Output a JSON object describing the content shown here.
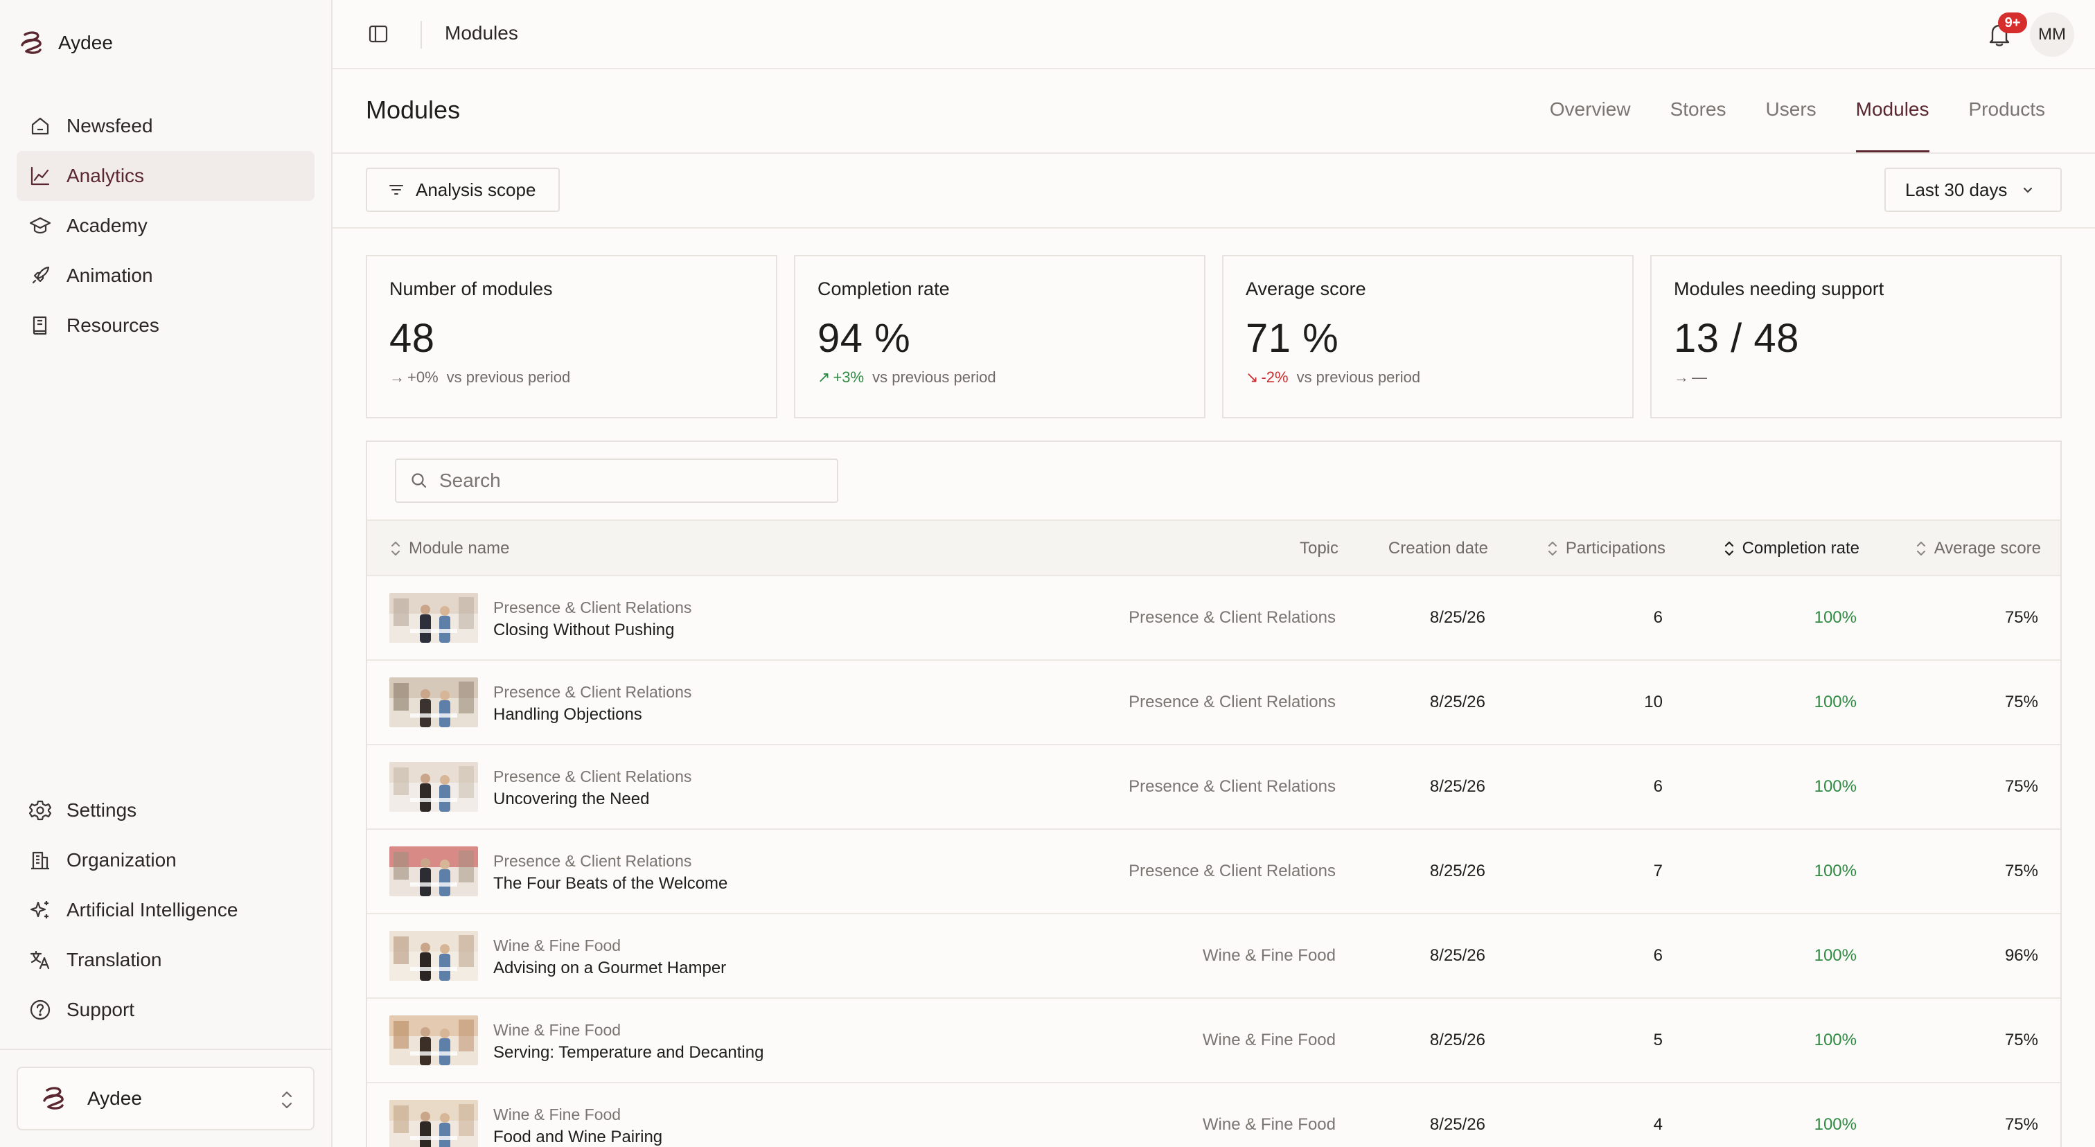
{
  "app": {
    "name": "Aydee"
  },
  "sidebar": {
    "main_items": [
      {
        "label": "Newsfeed",
        "icon": "home-icon"
      },
      {
        "label": "Analytics",
        "icon": "chart-icon",
        "active": true
      },
      {
        "label": "Academy",
        "icon": "graduation-cap-icon"
      },
      {
        "label": "Animation",
        "icon": "rocket-icon"
      },
      {
        "label": "Resources",
        "icon": "book-icon"
      }
    ],
    "bottom_items": [
      {
        "label": "Settings",
        "icon": "gear-icon"
      },
      {
        "label": "Organization",
        "icon": "building-icon"
      },
      {
        "label": "Artificial Intelligence",
        "icon": "sparkles-icon"
      },
      {
        "label": "Translation",
        "icon": "translate-icon"
      },
      {
        "label": "Support",
        "icon": "help-circle-icon"
      }
    ],
    "workspace": "Aydee"
  },
  "topbar": {
    "breadcrumb": "Modules",
    "notification_badge": "9+",
    "avatar_initials": "MM"
  },
  "page": {
    "title": "Modules",
    "tabs": [
      {
        "label": "Overview"
      },
      {
        "label": "Stores"
      },
      {
        "label": "Users"
      },
      {
        "label": "Modules",
        "active": true
      },
      {
        "label": "Products"
      }
    ]
  },
  "toolbar": {
    "scope_label": "Analysis scope",
    "range_label": "Last 30 days"
  },
  "kpis": [
    {
      "title": "Number of modules",
      "value": "48",
      "arrow": "→",
      "change": "+0%",
      "trend": "flat",
      "suffix": "vs previous period"
    },
    {
      "title": "Completion rate",
      "value": "94 %",
      "arrow": "↗",
      "change": "+3%",
      "trend": "up",
      "suffix": "vs previous period"
    },
    {
      "title": "Average score",
      "value": "71 %",
      "arrow": "↘",
      "change": "-2%",
      "trend": "down",
      "suffix": "vs previous period"
    },
    {
      "title": "Modules needing support",
      "value": "13 / 48",
      "arrow": "→",
      "change": "—",
      "trend": "flat",
      "suffix": ""
    }
  ],
  "table": {
    "search_placeholder": "Search",
    "columns": {
      "module_name": "Module name",
      "topic": "Topic",
      "creation_date": "Creation date",
      "participations": "Participations",
      "completion_rate": "Completion rate",
      "average_score": "Average score"
    },
    "rows": [
      {
        "topic": "Presence & Client Relations",
        "name": "Closing Without Pushing",
        "date": "8/25/26",
        "participations": "6",
        "completion": "100%",
        "score": "75%"
      },
      {
        "topic": "Presence & Client Relations",
        "name": "Handling Objections",
        "date": "8/25/26",
        "participations": "10",
        "completion": "100%",
        "score": "75%"
      },
      {
        "topic": "Presence & Client Relations",
        "name": "Uncovering the Need",
        "date": "8/25/26",
        "participations": "6",
        "completion": "100%",
        "score": "75%"
      },
      {
        "topic": "Presence & Client Relations",
        "name": "The Four Beats of the Welcome",
        "date": "8/25/26",
        "participations": "7",
        "completion": "100%",
        "score": "75%"
      },
      {
        "topic": "Wine & Fine Food",
        "name": "Advising on a Gourmet Hamper",
        "date": "8/25/26",
        "participations": "6",
        "completion": "100%",
        "score": "96%"
      },
      {
        "topic": "Wine & Fine Food",
        "name": "Serving: Temperature and Decanting",
        "date": "8/25/26",
        "participations": "5",
        "completion": "100%",
        "score": "75%"
      },
      {
        "topic": "Wine & Fine Food",
        "name": "Food and Wine Pairing",
        "date": "8/25/26",
        "participations": "4",
        "completion": "100%",
        "score": "75%"
      }
    ]
  },
  "colors": {
    "accent": "#5a2730",
    "positive": "#2f8a43",
    "negative": "#cc2f2f",
    "badge": "#d62d2d"
  }
}
